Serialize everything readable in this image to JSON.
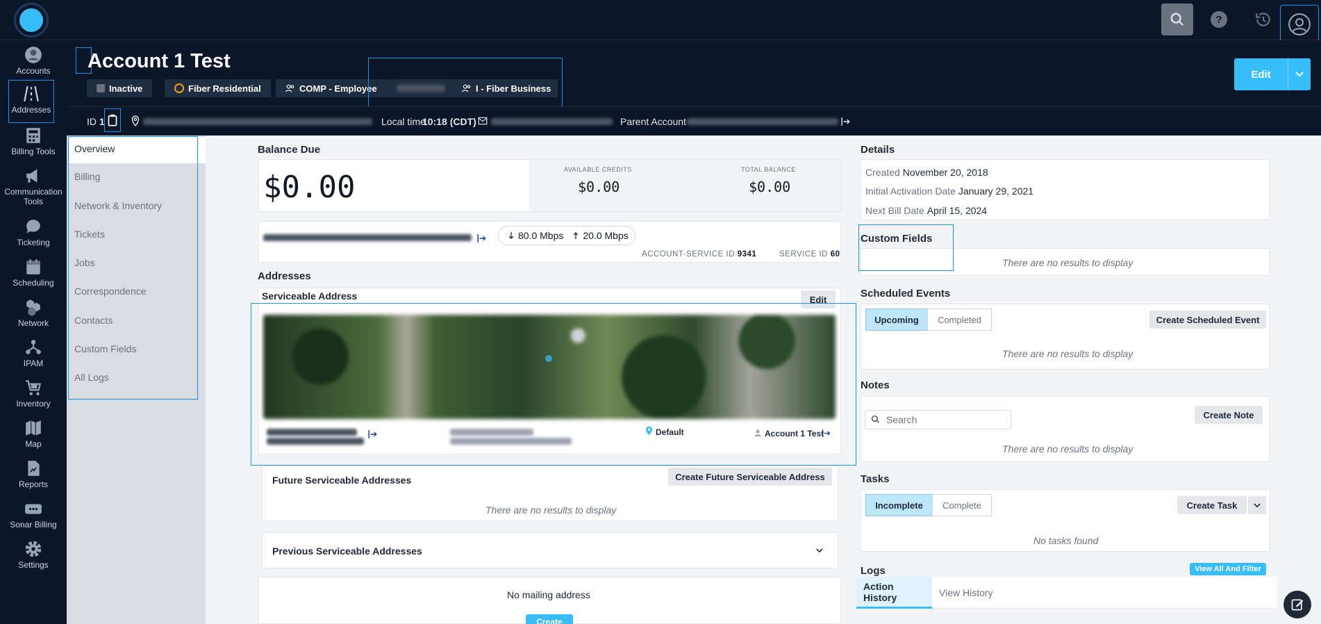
{
  "nav": [
    {
      "label": "Accounts",
      "icon": "person-icon"
    },
    {
      "label": "Addresses",
      "icon": "road-icon"
    },
    {
      "label": "Billing Tools",
      "icon": "calculator-icon"
    },
    {
      "label": "Communication Tools",
      "line1": "Communication",
      "line2": "Tools",
      "icon": "megaphone-icon"
    },
    {
      "label": "Ticketing",
      "icon": "chat-icon"
    },
    {
      "label": "Scheduling",
      "icon": "calendar-icon"
    },
    {
      "label": "Network",
      "icon": "hexagons-icon"
    },
    {
      "label": "IPAM",
      "icon": "network-nodes-icon"
    },
    {
      "label": "Inventory",
      "icon": "cart-icon"
    },
    {
      "label": "Map",
      "icon": "map-icon"
    },
    {
      "label": "Reports",
      "icon": "report-icon"
    },
    {
      "label": "Sonar Billing",
      "icon": "billing-card-icon"
    },
    {
      "label": "Settings",
      "icon": "gear-icon"
    }
  ],
  "account": {
    "title": "Account 1 Test",
    "chips": {
      "status": "Inactive",
      "type": "Fiber Residential",
      "group": "COMP - Employee",
      "fiber_business": "I - Fiber Business"
    },
    "edit_label": "Edit",
    "id_label": "ID",
    "id_value": "1",
    "local_time_label": "Local time",
    "local_time": "10:18 (CDT)",
    "parent_account_label": "Parent Account"
  },
  "submenu": [
    "Overview",
    "Billing",
    "Network & Inventory",
    "Tickets",
    "Jobs",
    "Correspondence",
    "Contacts",
    "Custom Fields",
    "All Logs"
  ],
  "balance": {
    "title": "Balance Due",
    "amount": "$0.00",
    "available_credits_label": "AVAILABLE CREDITS",
    "available_credits": "$0.00",
    "total_balance_label": "TOTAL BALANCE",
    "total_balance": "$0.00"
  },
  "service": {
    "down": "80.0 Mbps",
    "up": "20.0 Mbps",
    "account_service_id_label": "ACCOUNT-SERVICE ID",
    "account_service_id": "9341",
    "service_id_label": "SERVICE ID",
    "service_id": "60"
  },
  "addresses": {
    "title": "Addresses",
    "serviceable_title": "Serviceable Address",
    "edit_label": "Edit",
    "default_label": "Default",
    "account_link": "Account 1 Test",
    "future_title": "Future Serviceable Addresses",
    "create_future_label": "Create Future Serviceable Address",
    "future_empty": "There are no results to display",
    "previous_title": "Previous Serviceable Addresses",
    "mailing_empty": "No mailing address",
    "create_label": "Create"
  },
  "details": {
    "title": "Details",
    "created_label": "Created",
    "created": "November 20, 2018",
    "activation_label": "Initial Activation Date",
    "activation": "January 29, 2021",
    "next_bill_label": "Next Bill Date",
    "next_bill": "April 15, 2024"
  },
  "custom_fields": {
    "title": "Custom Fields",
    "empty": "There are no results to display"
  },
  "scheduled_events": {
    "title": "Scheduled Events",
    "tab_upcoming": "Upcoming",
    "tab_completed": "Completed",
    "create_label": "Create Scheduled Event",
    "empty": "There are no results to display"
  },
  "notes": {
    "title": "Notes",
    "search_placeholder": "Search",
    "create_label": "Create Note",
    "empty": "There are no results to display"
  },
  "tasks": {
    "title": "Tasks",
    "tab_incomplete": "Incomplete",
    "tab_complete": "Complete",
    "create_label": "Create Task",
    "empty": "No tasks found"
  },
  "logs": {
    "title": "Logs",
    "view_all_label": "View All And Filter",
    "tab_action": "Action History",
    "tab_view": "View History"
  },
  "colors": {
    "accent": "#38bdf8",
    "nav_bg": "#0b1628",
    "highlight": "#1d8fe1"
  }
}
